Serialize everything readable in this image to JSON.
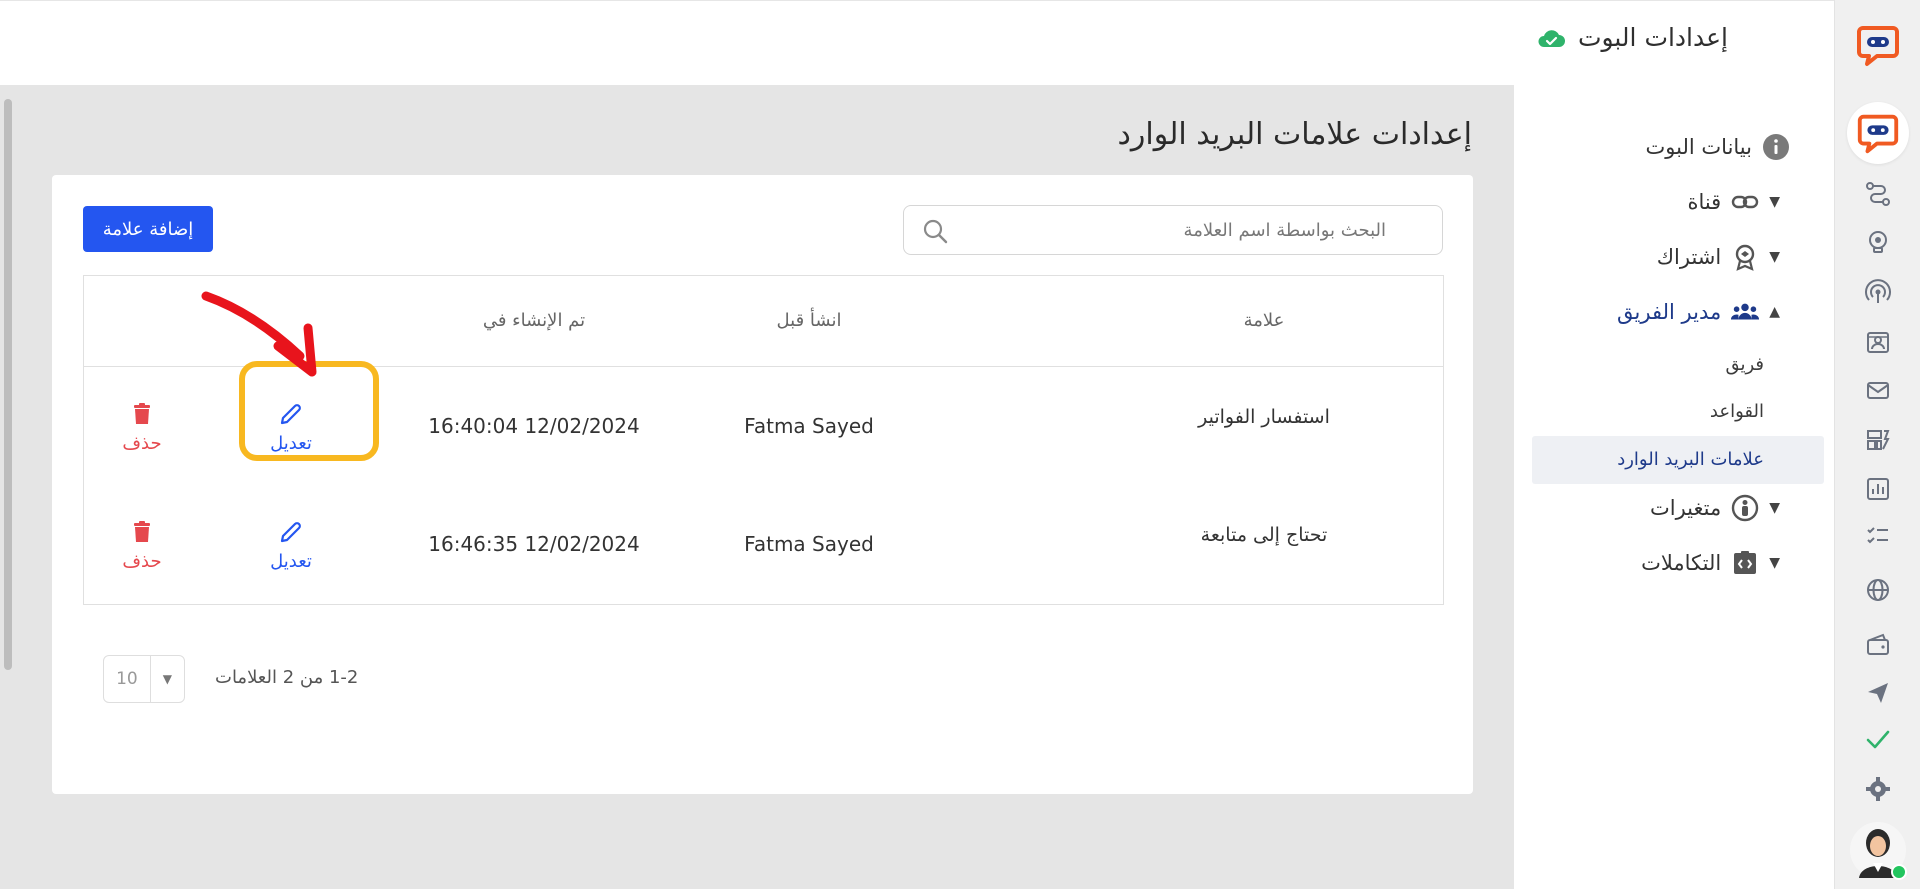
{
  "header": {
    "title": "إعدادات البوت",
    "status_icon": "cloud-check-icon",
    "status_color": "#2fb36b"
  },
  "rail": {
    "brand_color": "#f05a22",
    "icons": [
      "route-icon",
      "bulb-gear-icon",
      "broadcast-icon",
      "contact-card-icon",
      "mail-icon",
      "dashboard-icon",
      "chart-icon",
      "checklist-icon",
      "globe-icon",
      "wallet-icon",
      "send-icon",
      "check-icon",
      "gear-icon"
    ]
  },
  "sidebar": {
    "items": [
      {
        "label": "بيانات البوت",
        "icon": "info-icon",
        "caret": ""
      },
      {
        "label": "قناة",
        "icon": "link-icon",
        "caret": "▼"
      },
      {
        "label": "اشتراك",
        "icon": "badge-icon",
        "caret": "▼"
      },
      {
        "label": "مدير الفريق",
        "icon": "team-icon",
        "caret": "▲"
      },
      {
        "label": "متغيرات",
        "icon": "person-circle-icon",
        "caret": "▼"
      },
      {
        "label": "التكاملات",
        "icon": "code-box-icon",
        "caret": "▼"
      }
    ],
    "sub_items": [
      {
        "label": "فريق"
      },
      {
        "label": "القواعد"
      },
      {
        "label": "علامات البريد الوارد",
        "active": true
      }
    ]
  },
  "main": {
    "page_title": "إعدادات علامات البريد الوارد",
    "search_placeholder": "البحث بواسطة اسم العلامة",
    "add_button": "إضافة علامة",
    "columns": {
      "tag": "علامة",
      "created_by": "انشأ قبل",
      "created_at": "تم الإنشاء في"
    },
    "rows": [
      {
        "tag": "استفسار الفواتير",
        "created_by": "Fatma Sayed",
        "created_at": "16:40:04 12/02/2024",
        "edit": "تعديل",
        "delete": "حذف"
      },
      {
        "tag": "تحتاج إلى متابعة",
        "created_by": "Fatma Sayed",
        "created_at": "16:46:35 12/02/2024",
        "edit": "تعديل",
        "delete": "حذف"
      }
    ],
    "pagination": {
      "summary": "1-2 من 2 العلامات",
      "page_size": "10"
    }
  },
  "colors": {
    "primary": "#2456f0",
    "danger": "#e5484d",
    "highlight": "#f8b820",
    "arrow": "#e8141c"
  }
}
